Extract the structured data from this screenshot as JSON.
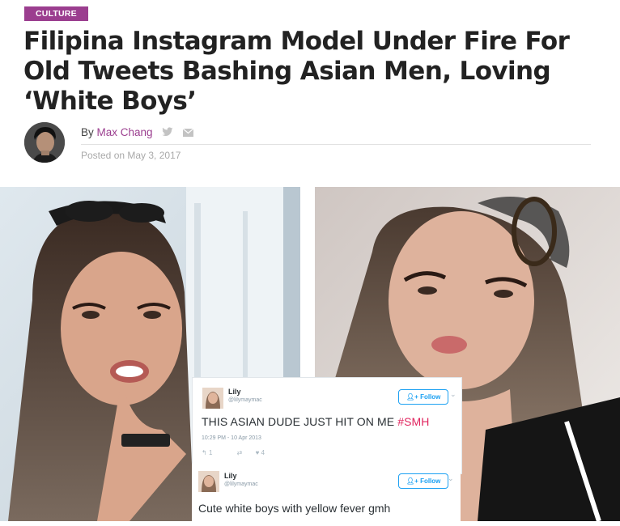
{
  "article": {
    "category": "CULTURE",
    "headline": "Filipina Instagram Model Under Fire For Old Tweets Bashing Asian Men, Loving ‘White Boys’",
    "byline_prefix": "By",
    "author": "Max Chang",
    "posted_on": "Posted on May 3, 2017"
  },
  "share_icons": [
    "twitter-icon",
    "email-icon"
  ],
  "colors": {
    "accent": "#9b3e8f",
    "twitter_blue": "#1da1f2",
    "hashtag": "#e0245e"
  },
  "tweets": [
    {
      "name": "Lily",
      "handle": "@lilymaymac",
      "follow_label": "Follow",
      "text_before": "THIS ASIAN DUDE JUST HIT ON ME ",
      "hashtag": "#SMH",
      "timestamp": "10:29 PM - 10 Apr 2013",
      "reply_count": "1",
      "like_count": "4"
    },
    {
      "name": "Lily",
      "handle": "@lilymaymac",
      "follow_label": "Follow",
      "text": "Cute white boys with yellow fever gmh"
    }
  ]
}
